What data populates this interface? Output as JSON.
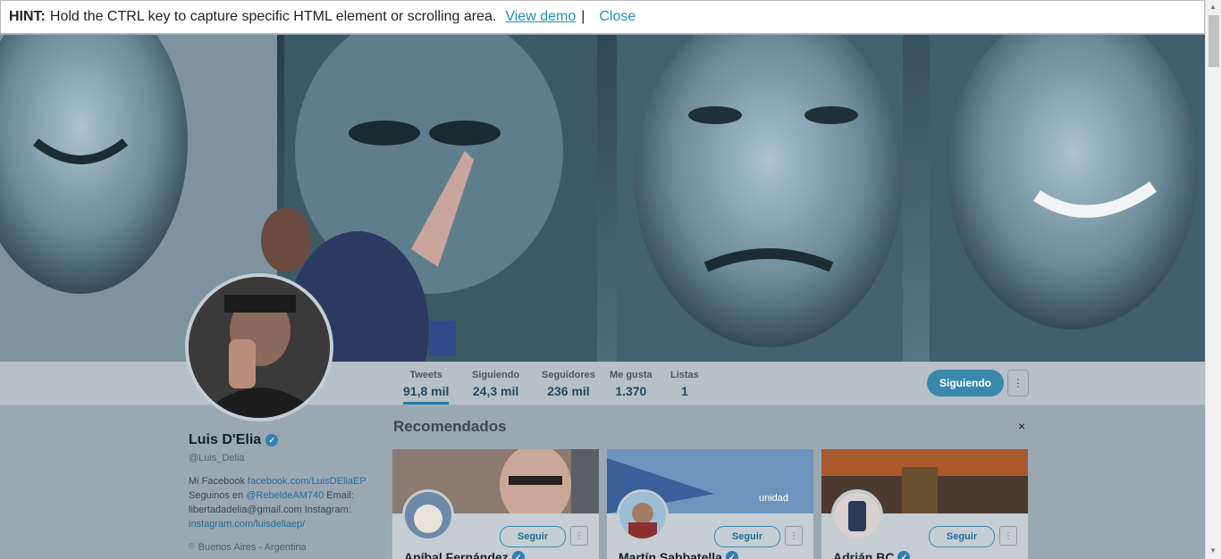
{
  "hint": {
    "label": "HINT:",
    "text": "Hold the CTRL key to capture specific HTML element or scrolling area.",
    "view_demo": "View demo",
    "separator": "|",
    "close": "Close"
  },
  "nav": {
    "stats": [
      {
        "label": "Tweets",
        "value": "91,8 mil"
      },
      {
        "label": "Siguiendo",
        "value": "24,3 mil"
      },
      {
        "label": "Seguidores",
        "value": "236 mil"
      },
      {
        "label": "Me gusta",
        "value": "1.370"
      },
      {
        "label": "Listas",
        "value": "1"
      }
    ],
    "follow_label": "Siguiendo",
    "more_icon": "⋮"
  },
  "profile": {
    "name": "Luis D'Elia",
    "verified_icon": "✓",
    "handle": "@Luis_Delia",
    "bio_prefix": "Mi Facebook ",
    "bio_link1": "facebook.com/LuisDEliaEP",
    "bio_mid1": " Seguinos en ",
    "bio_link2": "@RebeldeAM740",
    "bio_mid2": " Email: libertadadelia@gmail.com Instagram: ",
    "bio_link3": "instagram.com/luisdeliaep/",
    "location": "Buenos Aires - Argentina",
    "location_icon": "⌾"
  },
  "recommended": {
    "title": "Recomendados",
    "close_icon": "×",
    "cards": [
      {
        "name": "Aníbal Fernández",
        "follow": "Seguir"
      },
      {
        "name": "Martín Sabbatella",
        "follow": "Seguir"
      },
      {
        "name": "Adrián BC",
        "follow": "Seguir"
      }
    ],
    "cover_text_2": "unidad"
  },
  "colors": {
    "accent": "#3a89ad",
    "link": "#1b8fbf",
    "verified": "#2f7fb3"
  }
}
